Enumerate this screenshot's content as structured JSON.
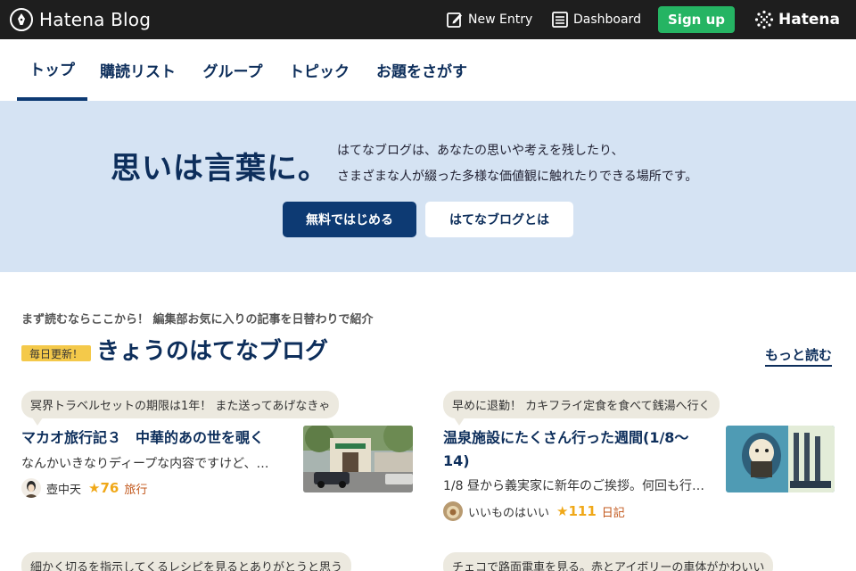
{
  "header": {
    "logo_text": "Hatena Blog",
    "new_entry": "New Entry",
    "dashboard": "Dashboard",
    "signup": "Sign up",
    "brand": "Hatena"
  },
  "nav": {
    "tabs": [
      {
        "label": "トップ",
        "active": true
      },
      {
        "label": "購読リスト",
        "active": false
      },
      {
        "label": "グループ",
        "active": false
      },
      {
        "label": "トピック",
        "active": false
      },
      {
        "label": "お題をさがす",
        "active": false
      }
    ]
  },
  "hero": {
    "headline": "思いは言葉に。",
    "desc_line1": "はてなブログは、あなたの思いや考えを残したり、",
    "desc_line2": "さまざまな人が綴った多様な価値観に触れたりできる場所です。",
    "primary_button": "無料ではじめる",
    "secondary_button": "はてなブログとは"
  },
  "section": {
    "subtitle": "まず読むならここから！ 編集部お気に入りの記事を日替わりで紹介",
    "badge": "毎日更新！",
    "title": "きょうのはてなブログ",
    "more_link": "もっと読む"
  },
  "cards": [
    {
      "comment": "冥界トラベルセットの期限は1年！ また送ってあげなきゃ",
      "title": "マカオ旅行記３　中華的あの世を覗く",
      "excerpt": "なんかいきなりディープな内容ですけど、…",
      "author": "壺中天",
      "stars": "★76",
      "category": "旅行"
    },
    {
      "comment": "早めに退勤！ カキフライ定食を食べて銭湯へ行く",
      "title": "温泉施設にたくさん行った週間(1/8〜14)",
      "excerpt": "1/8 昼から義実家に新年のご挨拶。何回も行…",
      "author": "いいものはいい",
      "stars": "★111",
      "category": "日記"
    },
    {
      "comment": "細かく切るを指示してくるレシピを見るとありがとうと思う"
    },
    {
      "comment": "チェコで路面電車を見る。赤とアイボリーの車体がかわいい"
    }
  ],
  "colors": {
    "topbar": "#1e1e1e",
    "navy": "#0d2e5b",
    "hero_bg": "#d5e3f3",
    "signup_green": "#25b463",
    "star": "#f0a818",
    "category": "#c2571b"
  }
}
